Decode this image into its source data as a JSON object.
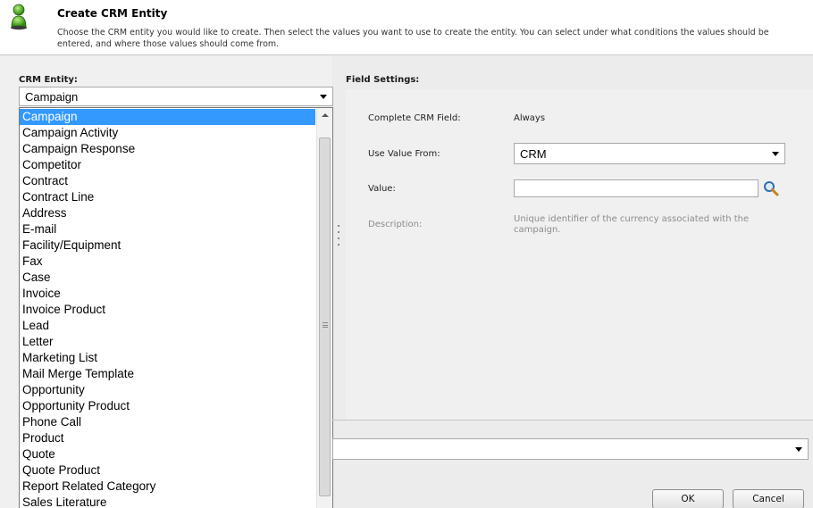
{
  "header": {
    "title": "Create CRM Entity",
    "description": "Choose the CRM entity you would like to create. Then select the values you want to use to create the entity. You can select under what conditions the values should be entered, and where those values should come from.",
    "icon": "person-icon"
  },
  "entity": {
    "label": "CRM Entity:",
    "selected": "Campaign",
    "options": [
      "Campaign",
      "Campaign Activity",
      "Campaign Response",
      "Competitor",
      "Contract",
      "Contract Line",
      "Address",
      "E-mail",
      "Facility/Equipment",
      "Fax",
      "Case",
      "Invoice",
      "Invoice Product",
      "Lead",
      "Letter",
      "Marketing List",
      "Mail Merge Template",
      "Opportunity",
      "Opportunity Product",
      "Phone Call",
      "Product",
      "Quote",
      "Quote Product",
      "Report Related Category",
      "Sales Literature"
    ],
    "highlighted_index": 0
  },
  "field_settings": {
    "label": "Field Settings:",
    "complete_label": "Complete CRM Field:",
    "complete_value": "Always",
    "use_value_from_label": "Use Value From:",
    "use_value_from_value": "CRM",
    "value_label": "Value:",
    "value_input": "",
    "description_label": "Description:",
    "description_value": "Unique identifier of the currency associated with the campaign."
  },
  "buttons": {
    "ok": "OK",
    "cancel": "Cancel"
  },
  "colors": {
    "selection": "#3399ff",
    "panel": "#f0f0f0"
  }
}
